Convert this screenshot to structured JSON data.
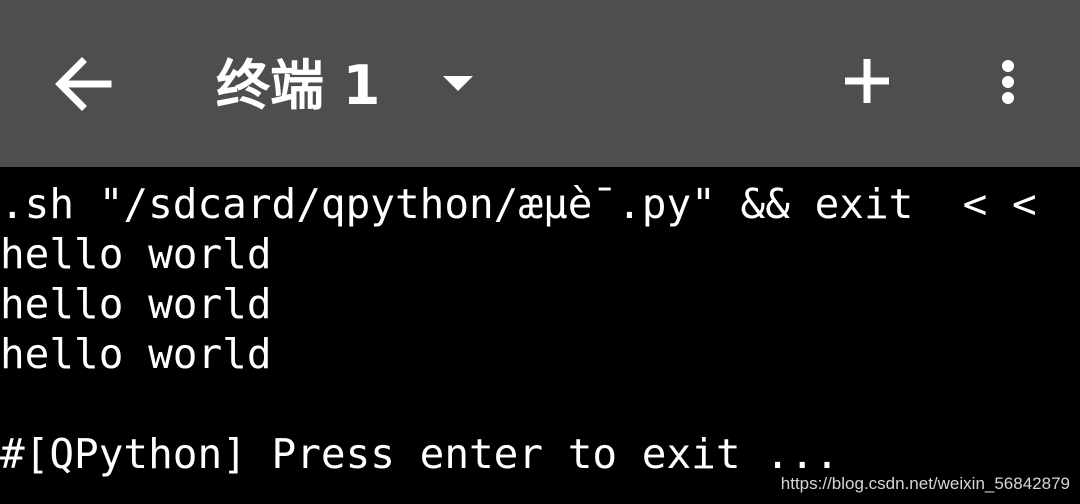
{
  "toolbar": {
    "title": "终端 1",
    "background": "#4e4e4e",
    "icons": {
      "back": "arrow-left-icon",
      "dropdown": "caret-down-icon",
      "add": "plus-icon",
      "menu": "more-vertical-icon"
    }
  },
  "terminal": {
    "background": "#000000",
    "foreground": "#ffffff",
    "lines": [
      ".sh \"/sdcard/qpython/æµè¯.py\" && exit  < <",
      "hello world",
      "hello world",
      "hello world",
      "",
      "#[QPython] Press enter to exit ..."
    ]
  },
  "watermark": "https://blog.csdn.net/weixin_56842879"
}
